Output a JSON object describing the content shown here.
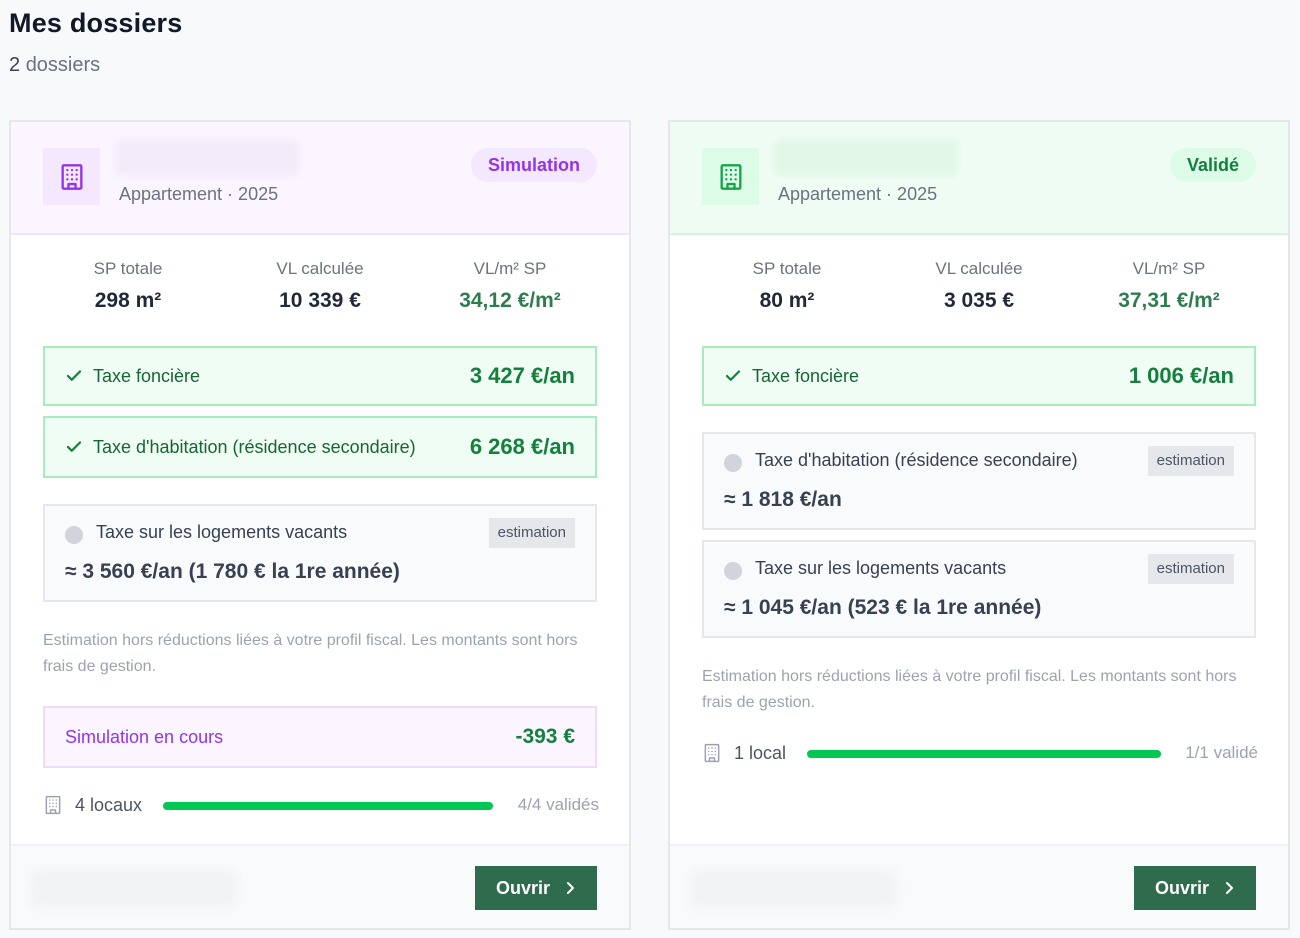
{
  "page": {
    "title": "Mes dossiers",
    "count": "2",
    "count_label": "dossiers"
  },
  "colors": {
    "primary_button": "#2f6b4d",
    "simulation_accent": "#9333ea",
    "validated_accent": "#15803d",
    "progress_fill": "#00c853"
  },
  "cards": [
    {
      "icon": "building-icon",
      "subtitle": "Appartement · 2025",
      "status": "Simulation",
      "stats": [
        {
          "label": "SP totale",
          "value": "298 m²"
        },
        {
          "label": "VL calculée",
          "value": "10 339 €"
        },
        {
          "label": "VL/m² SP",
          "value": "34,12 €/m²"
        }
      ],
      "confirmed_taxes": [
        {
          "name": "Taxe foncière",
          "amount": "3 427 €/an"
        },
        {
          "name": "Taxe d'habitation (résidence secondaire)",
          "amount": "6 268 €/an"
        }
      ],
      "estimated_taxes": [
        {
          "name": "Taxe sur les logements vacants",
          "badge": "estimation",
          "amount": "≈ 3 560 €/an (1 780 € la 1re année)"
        }
      ],
      "note": "Estimation hors réductions liées à votre profil fiscal. Les montants sont hors frais de gestion.",
      "simulation": {
        "label": "Simulation en cours",
        "amount": "-393 €"
      },
      "locals": {
        "label": "4 locaux",
        "validated": "4/4 validés",
        "progress": 1.0
      },
      "open_label": "Ouvrir"
    },
    {
      "icon": "building-icon",
      "subtitle": "Appartement · 2025",
      "status": "Validé",
      "stats": [
        {
          "label": "SP totale",
          "value": "80 m²"
        },
        {
          "label": "VL calculée",
          "value": "3 035 €"
        },
        {
          "label": "VL/m² SP",
          "value": "37,31 €/m²"
        }
      ],
      "confirmed_taxes": [
        {
          "name": "Taxe foncière",
          "amount": "1 006 €/an"
        }
      ],
      "estimated_taxes": [
        {
          "name": "Taxe d'habitation (résidence secondaire)",
          "badge": "estimation",
          "amount": "≈ 1 818 €/an"
        },
        {
          "name": "Taxe sur les logements vacants",
          "badge": "estimation",
          "amount": "≈ 1 045 €/an (523 € la 1re année)"
        }
      ],
      "note": "Estimation hors réductions liées à votre profil fiscal. Les montants sont hors frais de gestion.",
      "locals": {
        "label": "1 local",
        "validated": "1/1 validé",
        "progress": 1.0
      },
      "open_label": "Ouvrir"
    }
  ]
}
